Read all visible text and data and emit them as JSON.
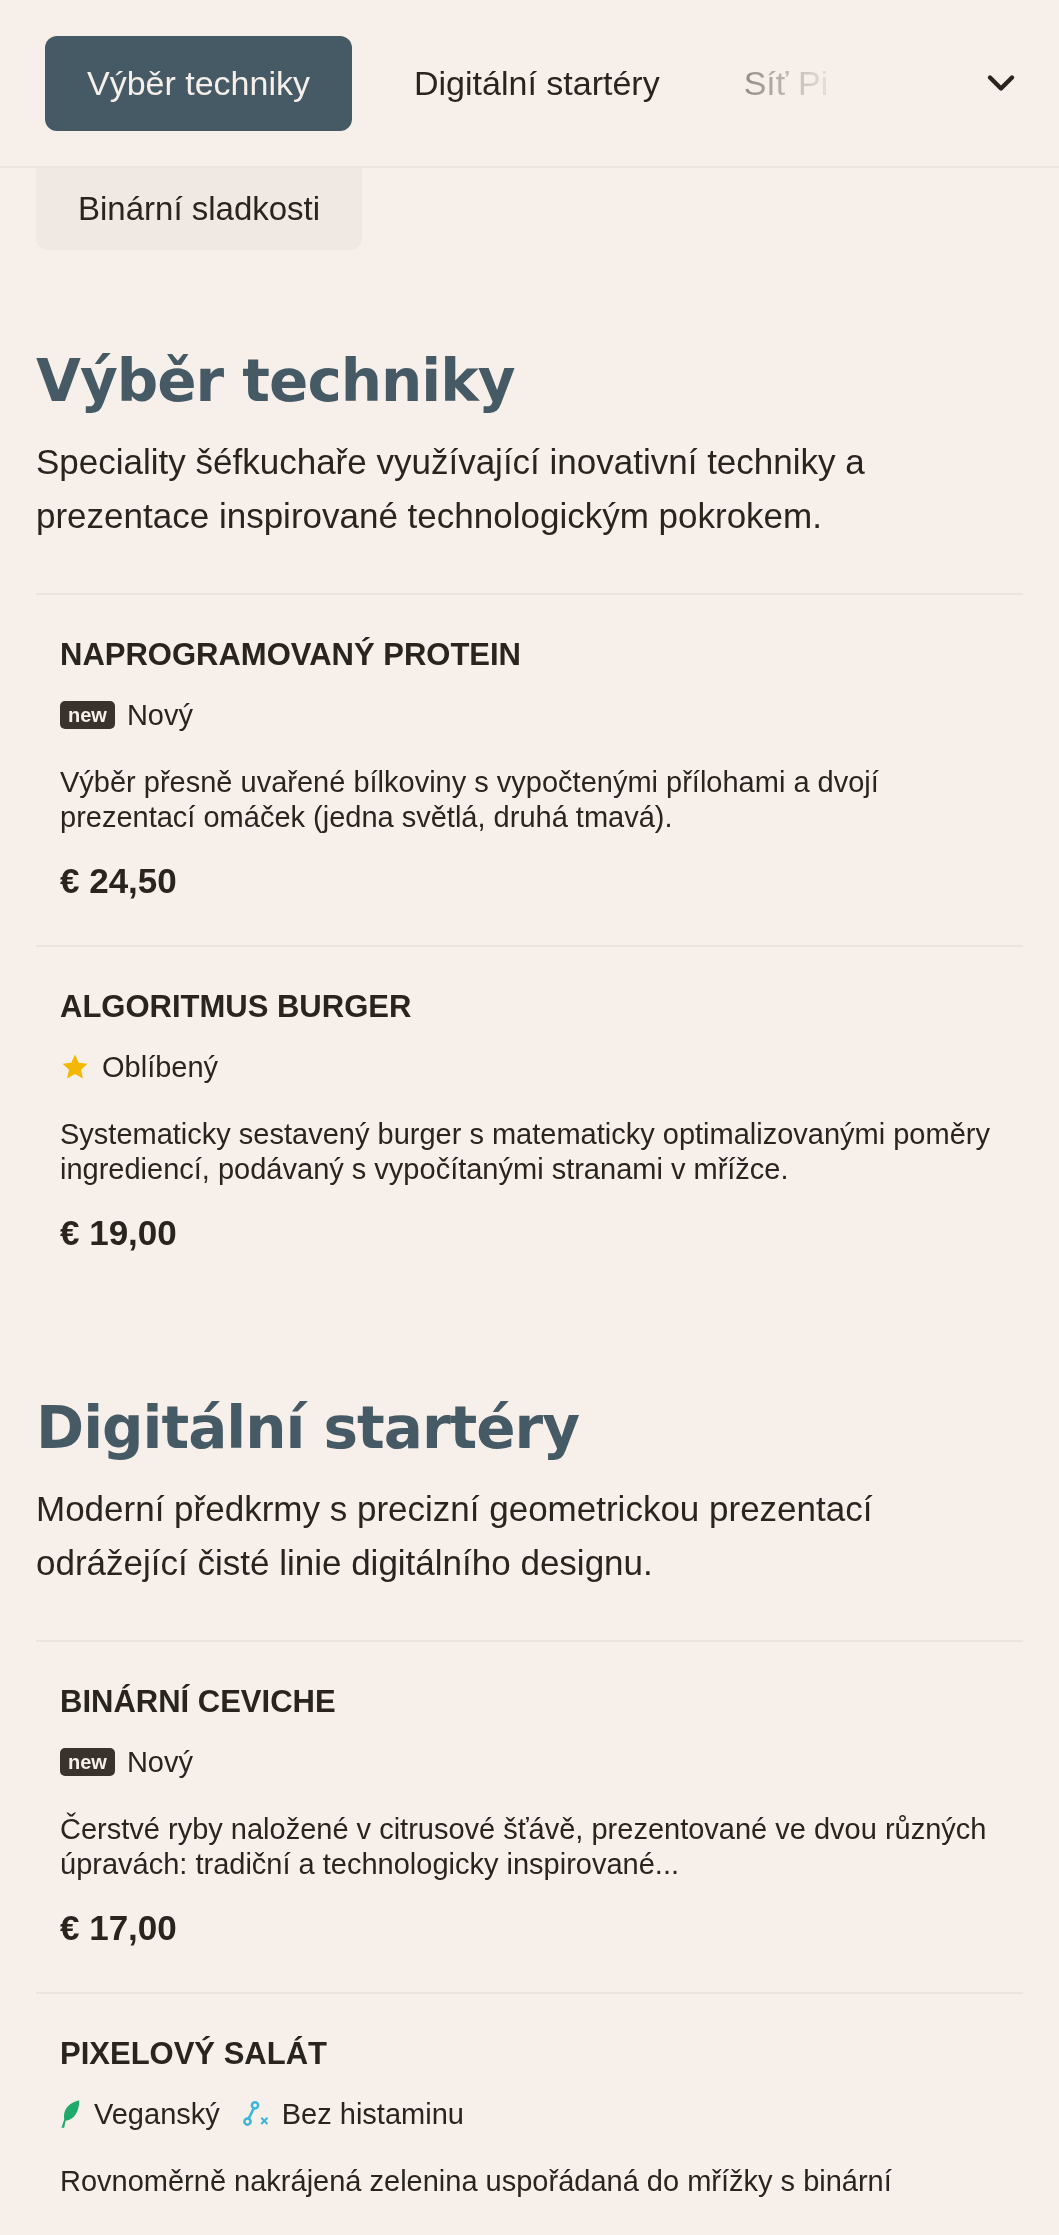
{
  "header": {
    "tabs": [
      {
        "label": "Výběr techniky",
        "selected": true,
        "faded": false
      },
      {
        "label": "Digitální startéry",
        "selected": false,
        "faded": false
      },
      {
        "label": "Síť Pi",
        "selected": false,
        "faded": true
      }
    ],
    "more_tabs": [
      {
        "label": "Binární sladkosti",
        "selected": false
      }
    ]
  },
  "sections": [
    {
      "title": "Výběr techniky",
      "description": "Speciality šéfkuchaře využívající inovativní techniky a prezentace inspirované technologickým pokrokem.",
      "items": [
        {
          "name": "NAPROGRAMOVANÝ PROTEIN",
          "tags": [
            {
              "kind": "new",
              "badge": "new",
              "label": "Nový"
            }
          ],
          "description": "Výběr přesně uvařené bílkoviny s vypočtenými přílohami a dvojí prezentací omáček (jedna světlá, druhá tmavá).",
          "price": "€ 24,50"
        },
        {
          "name": "ALGORITMUS BURGER",
          "tags": [
            {
              "kind": "star",
              "label": "Oblíbený"
            }
          ],
          "description": "Systematicky sestavený burger s matematicky optimalizovanými poměry ingrediencí, podávaný s vypočítanými stranami v mřížce.",
          "price": "€ 19,00"
        }
      ]
    },
    {
      "title": "Digitální startéry",
      "description": "Moderní předkrmy s precizní geometrickou prezentací odrážející čisté linie digitálního designu.",
      "items": [
        {
          "name": "BINÁRNÍ CEVICHE",
          "tags": [
            {
              "kind": "new",
              "badge": "new",
              "label": "Nový"
            }
          ],
          "description": "Čerstvé ryby naložené v citrusové šťávě, prezentované ve dvou různých úpravách: tradiční a technologicky inspirované...",
          "price": "€ 17,00"
        },
        {
          "name": "PIXELOVÝ SALÁT",
          "tags": [
            {
              "kind": "vegan",
              "label": "Veganský"
            },
            {
              "kind": "histamine",
              "label": "Bez histaminu"
            }
          ],
          "description": "Rovnoměrně nakrájená zelenina uspořádaná do mřížky s binární"
        }
      ]
    }
  ]
}
